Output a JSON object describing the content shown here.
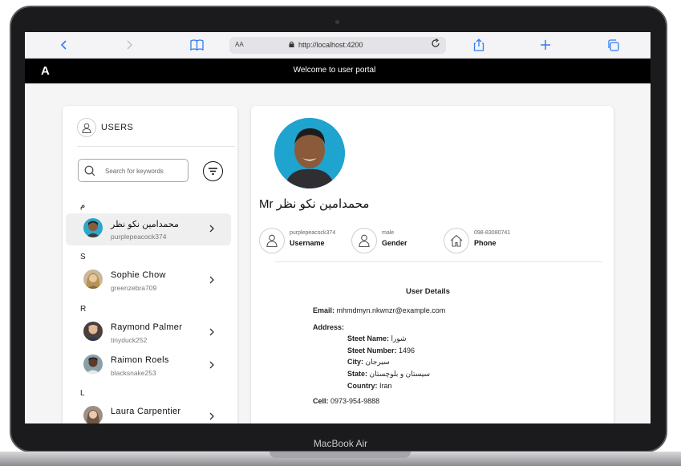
{
  "device": {
    "label": "MacBook Air"
  },
  "browser": {
    "text_size_label": "AA",
    "url": "http://localhost:4200",
    "icons": [
      "back-icon",
      "forward-icon",
      "reader-icon",
      "lock-icon",
      "reload-icon",
      "share-icon",
      "new-tab-icon",
      "tabs-icon"
    ]
  },
  "app": {
    "logo": "A",
    "title": "Welcome to user portal"
  },
  "sidebar": {
    "title": "USERS",
    "search_placeholder": "Search for keywords",
    "groups": [
      {
        "letter": "م",
        "users": [
          {
            "name": "محمدامین نکو نظر",
            "username": "purplepeacock374",
            "selected": true
          }
        ]
      },
      {
        "letter": "S",
        "users": [
          {
            "name": "Sophie Chow",
            "username": "greenzebra709"
          }
        ]
      },
      {
        "letter": "R",
        "users": [
          {
            "name": "Raymond Palmer",
            "username": "tinyduck252"
          },
          {
            "name": "Raimon Roels",
            "username": "blacksnake253"
          }
        ]
      },
      {
        "letter": "L",
        "users": [
          {
            "name": "Laura Carpentier",
            "username": ""
          }
        ]
      }
    ]
  },
  "detail": {
    "name": "Mr محمدامین نکو نظر",
    "username": {
      "value": "purplepeacock374",
      "label": "Username"
    },
    "gender": {
      "value": "male",
      "label": "Gender"
    },
    "phone": {
      "value": "098-83080741",
      "label": "Phone"
    },
    "section_title": "User Details",
    "email_label": "Email:",
    "email": "mhmdmyn.nkwnzr@example.com",
    "address_label": "Address:",
    "street_name_label": "Steet Name:",
    "street_name": "شورا",
    "street_number_label": "Steet Number:",
    "street_number": "1496",
    "city_label": "City:",
    "city": "سیرجان",
    "state_label": "State:",
    "state": "سیستان و بلوچستان",
    "country_label": "Country:",
    "country": "Iran",
    "cell_label": "Cell:",
    "cell": "0973-954-9888"
  },
  "colors": {
    "link_blue": "#2f7bf5",
    "nav_bg": "#000000",
    "avatar_bg": "#1fa3cf",
    "selected_row": "#efefef"
  }
}
